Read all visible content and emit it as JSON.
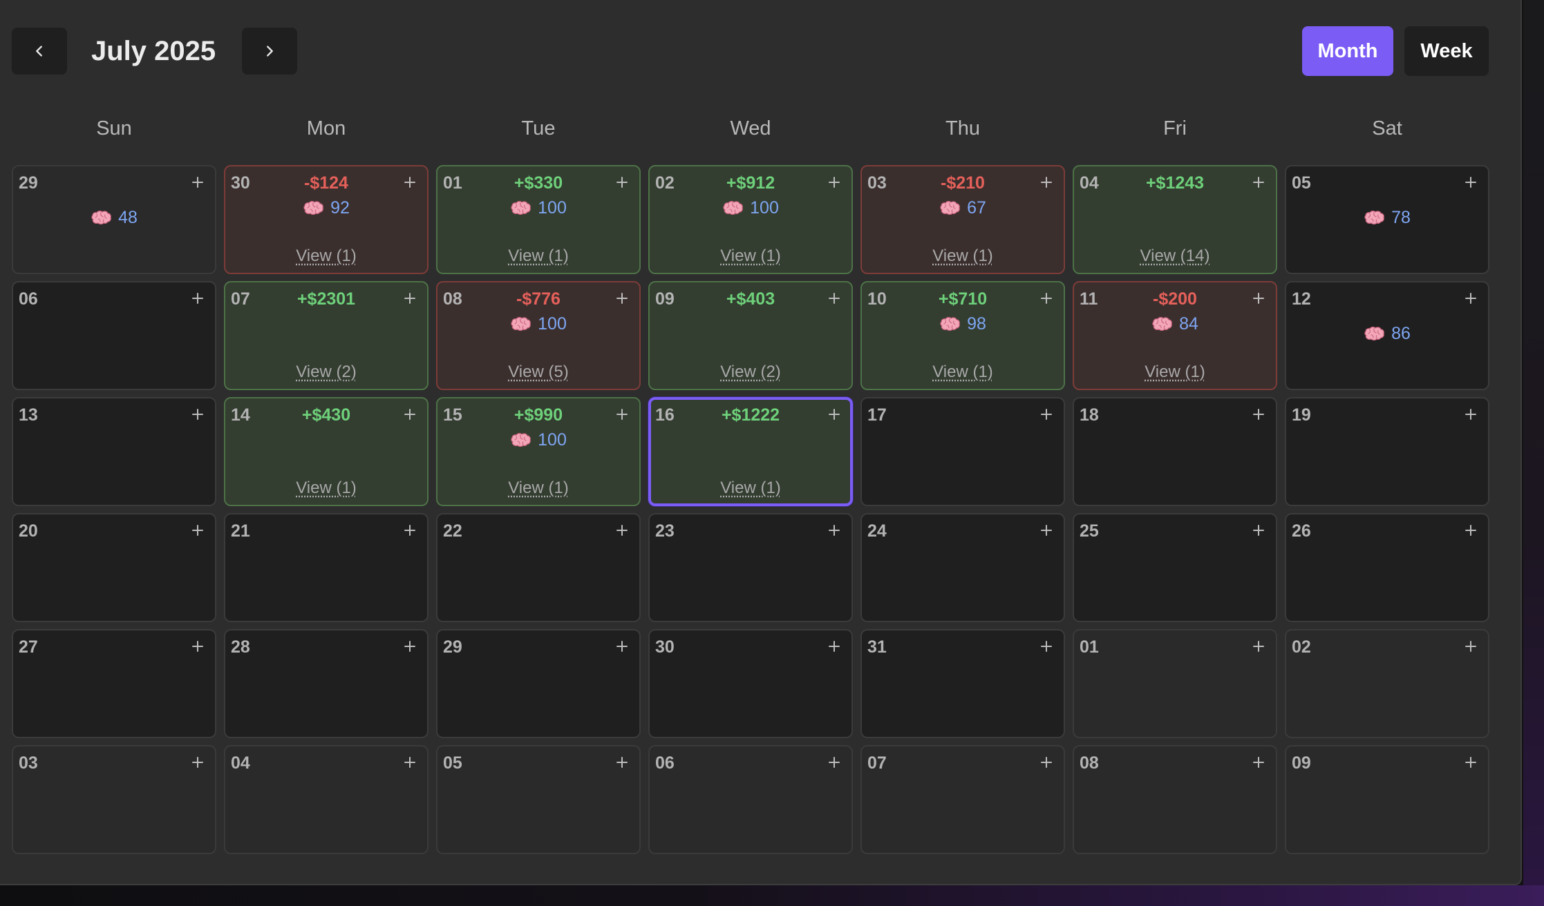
{
  "header": {
    "title": "July 2025",
    "prev_icon": "chevron-left-icon",
    "next_icon": "chevron-right-icon",
    "views": [
      {
        "label": "Month",
        "active": true
      },
      {
        "label": "Week",
        "active": false
      }
    ]
  },
  "weekdays": [
    "Sun",
    "Mon",
    "Tue",
    "Wed",
    "Thu",
    "Fri",
    "Sat"
  ],
  "colors": {
    "accent": "#7b5cf5",
    "profit_text": "#6ed07a",
    "loss_text": "#e5605a",
    "score_text": "#7ea6f2",
    "profit_bg": "#333d30",
    "loss_bg": "#3b2f2e"
  },
  "add_icon": "plus-icon",
  "score_icon": "brain-icon",
  "weeks": [
    [
      {
        "day": "29",
        "outside": true,
        "score": "48"
      },
      {
        "day": "30",
        "outside": true,
        "status": "loss",
        "pnl": "-$124",
        "score": "92",
        "view": "View (1)"
      },
      {
        "day": "01",
        "status": "profit",
        "pnl": "+$330",
        "score": "100",
        "view": "View (1)"
      },
      {
        "day": "02",
        "status": "profit",
        "pnl": "+$912",
        "score": "100",
        "view": "View (1)"
      },
      {
        "day": "03",
        "status": "loss",
        "pnl": "-$210",
        "score": "67",
        "view": "View (1)"
      },
      {
        "day": "04",
        "status": "profit",
        "pnl": "+$1243",
        "view": "View (14)"
      },
      {
        "day": "05",
        "score": "78"
      }
    ],
    [
      {
        "day": "06"
      },
      {
        "day": "07",
        "status": "profit",
        "pnl": "+$2301",
        "view": "View (2)"
      },
      {
        "day": "08",
        "status": "loss",
        "pnl": "-$776",
        "score": "100",
        "view": "View (5)"
      },
      {
        "day": "09",
        "status": "profit",
        "pnl": "+$403",
        "view": "View (2)"
      },
      {
        "day": "10",
        "status": "profit",
        "pnl": "+$710",
        "score": "98",
        "view": "View (1)"
      },
      {
        "day": "11",
        "status": "loss",
        "pnl": "-$200",
        "score": "84",
        "view": "View (1)"
      },
      {
        "day": "12",
        "score": "86"
      }
    ],
    [
      {
        "day": "13"
      },
      {
        "day": "14",
        "status": "profit",
        "pnl": "+$430",
        "view": "View (1)"
      },
      {
        "day": "15",
        "status": "profit",
        "pnl": "+$990",
        "score": "100",
        "view": "View (1)"
      },
      {
        "day": "16",
        "status": "profit",
        "pnl": "+$1222",
        "view": "View (1)",
        "today": true
      },
      {
        "day": "17"
      },
      {
        "day": "18"
      },
      {
        "day": "19"
      }
    ],
    [
      {
        "day": "20"
      },
      {
        "day": "21"
      },
      {
        "day": "22"
      },
      {
        "day": "23"
      },
      {
        "day": "24"
      },
      {
        "day": "25"
      },
      {
        "day": "26"
      }
    ],
    [
      {
        "day": "27"
      },
      {
        "day": "28"
      },
      {
        "day": "29"
      },
      {
        "day": "30"
      },
      {
        "day": "31"
      },
      {
        "day": "01",
        "outside": true
      },
      {
        "day": "02",
        "outside": true
      }
    ],
    [
      {
        "day": "03",
        "outside": true
      },
      {
        "day": "04",
        "outside": true
      },
      {
        "day": "05",
        "outside": true
      },
      {
        "day": "06",
        "outside": true
      },
      {
        "day": "07",
        "outside": true
      },
      {
        "day": "08",
        "outside": true
      },
      {
        "day": "09",
        "outside": true
      }
    ]
  ]
}
